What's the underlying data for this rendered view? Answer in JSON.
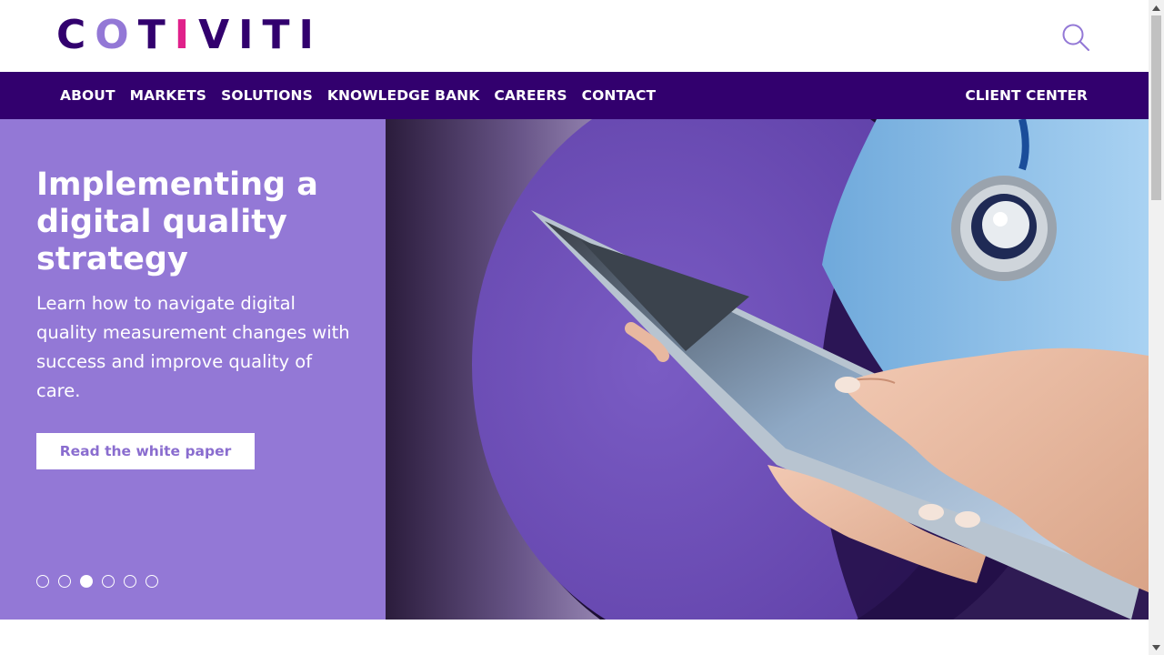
{
  "header": {
    "logo": {
      "letters": [
        {
          "char": "C",
          "color": "#32006e"
        },
        {
          "char": "O",
          "color": "#9378d6"
        },
        {
          "char": "T",
          "color": "#32006e"
        },
        {
          "char": "I",
          "color": "#e0218a"
        },
        {
          "char": "V",
          "color": "#32006e"
        },
        {
          "char": "I",
          "color": "#32006e"
        },
        {
          "char": "T",
          "color": "#32006e"
        },
        {
          "char": "I",
          "color": "#32006e"
        }
      ]
    },
    "search_icon": "search-icon"
  },
  "nav": {
    "items": [
      "ABOUT",
      "MARKETS",
      "SOLUTIONS",
      "KNOWLEDGE BANK",
      "CAREERS",
      "CONTACT"
    ],
    "client_center": "CLIENT CENTER"
  },
  "hero": {
    "title": "Implementing a digital quality strategy",
    "subtitle": "Learn how to navigate digital quality measurement changes with success and improve quality of care.",
    "button_label": "Read the white paper",
    "slides_total": 6,
    "active_slide": 3
  },
  "colors": {
    "brand_dark": "#32006e",
    "brand_light": "#9378d6",
    "accent_pink": "#e0218a",
    "button_text": "#8a6dcf",
    "scrub_blue": "#7fb8e6"
  }
}
